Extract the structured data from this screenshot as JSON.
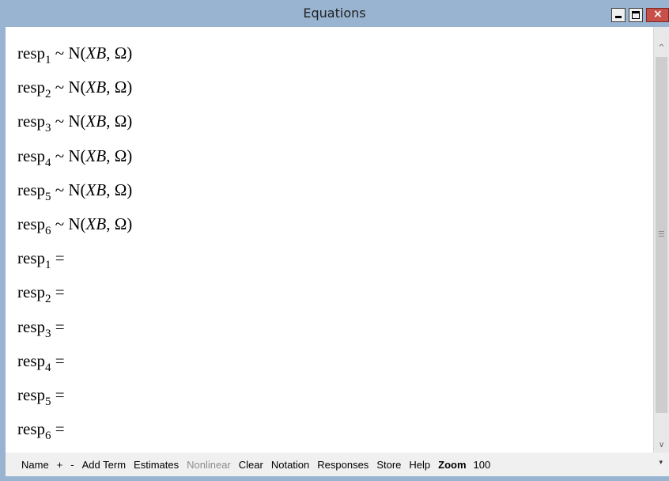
{
  "window": {
    "title": "Equations",
    "minimize_glyph": "",
    "maximize_glyph": "",
    "close_glyph": "×"
  },
  "equations": [
    {
      "lhs": "resp",
      "sub": "1",
      "rhs_pre": " ~ N(",
      "rhs_italic": "XB",
      "rhs_post": ", Ω)"
    },
    {
      "lhs": "resp",
      "sub": "2",
      "rhs_pre": " ~ N(",
      "rhs_italic": "XB",
      "rhs_post": ", Ω)"
    },
    {
      "lhs": "resp",
      "sub": "3",
      "rhs_pre": " ~ N(",
      "rhs_italic": "XB",
      "rhs_post": ", Ω)"
    },
    {
      "lhs": "resp",
      "sub": "4",
      "rhs_pre": " ~ N(",
      "rhs_italic": "XB",
      "rhs_post": ", Ω)"
    },
    {
      "lhs": "resp",
      "sub": "5",
      "rhs_pre": " ~ N(",
      "rhs_italic": "XB",
      "rhs_post": ", Ω)"
    },
    {
      "lhs": "resp",
      "sub": "6",
      "rhs_pre": " ~ N(",
      "rhs_italic": "XB",
      "rhs_post": ", Ω)"
    },
    {
      "lhs": "resp",
      "sub": "1",
      "rhs_pre": " =",
      "rhs_italic": "",
      "rhs_post": ""
    },
    {
      "lhs": "resp",
      "sub": "2",
      "rhs_pre": " =",
      "rhs_italic": "",
      "rhs_post": ""
    },
    {
      "lhs": "resp",
      "sub": "3",
      "rhs_pre": " =",
      "rhs_italic": "",
      "rhs_post": ""
    },
    {
      "lhs": "resp",
      "sub": "4",
      "rhs_pre": " =",
      "rhs_italic": "",
      "rhs_post": ""
    },
    {
      "lhs": "resp",
      "sub": "5",
      "rhs_pre": " =",
      "rhs_italic": "",
      "rhs_post": ""
    },
    {
      "lhs": "resp",
      "sub": "6",
      "rhs_pre": " =",
      "rhs_italic": "",
      "rhs_post": ""
    }
  ],
  "scrollbar": {
    "up_glyph": "^",
    "down_glyph": "∨"
  },
  "toolbar": {
    "name": "Name",
    "plus": "+",
    "minus": "-",
    "add_term": "Add Term",
    "estimates": "Estimates",
    "nonlinear": "Nonlinear",
    "clear": "Clear",
    "notation": "Notation",
    "responses": "Responses",
    "store": "Store",
    "help": "Help",
    "zoom_label": "Zoom",
    "zoom_value": "100",
    "dropdown_glyph": "▾"
  }
}
